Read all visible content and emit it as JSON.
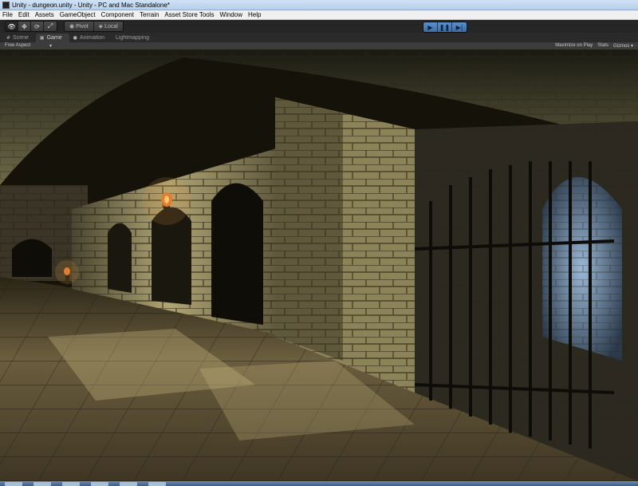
{
  "window": {
    "title": "Unity - dungeon.unity - Unity - PC and Mac Standalone*"
  },
  "menu": {
    "items": [
      "File",
      "Edit",
      "Assets",
      "GameObject",
      "Component",
      "Terrain",
      "Asset Store Tools",
      "Window",
      "Help"
    ]
  },
  "toolbar": {
    "transform_tools": [
      {
        "name": "view-hand-tool",
        "glyph": "👁"
      },
      {
        "name": "move-tool",
        "glyph": "✥"
      },
      {
        "name": "rotate-tool",
        "glyph": "⟳"
      },
      {
        "name": "scale-tool",
        "glyph": "⤢"
      }
    ],
    "pivot_label": "Pivot",
    "local_label": "Local",
    "play_glyph": "▶",
    "pause_glyph": "❚❚",
    "step_glyph": "▶|"
  },
  "tabs": [
    {
      "label": "Scene",
      "icon": "#",
      "active": false
    },
    {
      "label": "Game",
      "icon": "▣",
      "active": true
    },
    {
      "label": "Animation",
      "icon": "●",
      "active": false
    },
    {
      "label": "Lightmapping",
      "icon": "",
      "active": false
    }
  ],
  "game_view": {
    "aspect_label": "Free Aspect",
    "aspect_arrow": "▾",
    "maximize_label": "Maximize on Play",
    "stats_label": "Stats",
    "gizmos_label": "Gizmos ▾"
  },
  "colors": {
    "accent_play": "#4a7fc0",
    "editor_dark": "#262626"
  }
}
